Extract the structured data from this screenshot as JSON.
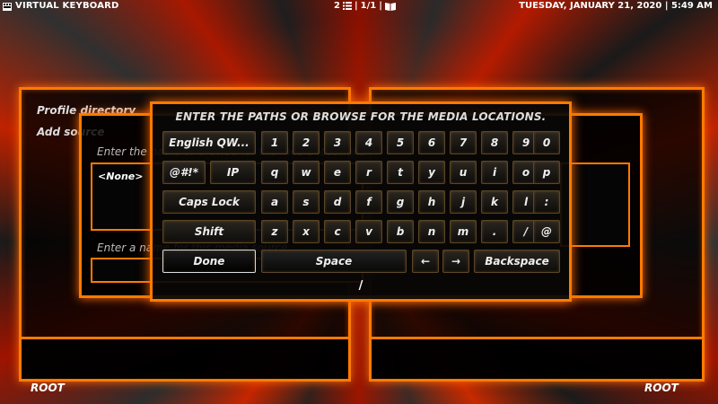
{
  "header": {
    "title": "VIRTUAL KEYBOARD",
    "page_indicator": "2",
    "page_count": "1/1",
    "datetime": "TUESDAY, JANUARY 21, 2020 | 5:49 AM"
  },
  "left_panel": {
    "items": [
      "Profile directory",
      "Add source"
    ],
    "footer": "ROOT"
  },
  "right_panel": {
    "footer": "ROOT"
  },
  "source_dialog": {
    "label_paths": "Enter the paths or browse for the media locations.",
    "paths": [
      "<None>"
    ],
    "label_name": "Enter a name for this media source."
  },
  "keyboard": {
    "heading": "ENTER THE PATHS OR BROWSE FOR THE MEDIA LOCATIONS.",
    "layout_button": "English QW...",
    "symbols_button": "@#!*",
    "ip_button": "IP",
    "caps_button": "Caps Lock",
    "shift_button": "Shift",
    "done_button": "Done",
    "space_button": "Space",
    "left_arrow": "←",
    "right_arrow": "→",
    "backspace_button": "Backspace",
    "row1": [
      "1",
      "2",
      "3",
      "4",
      "5",
      "6",
      "7",
      "8",
      "9",
      "0"
    ],
    "row2": [
      "q",
      "w",
      "e",
      "r",
      "t",
      "y",
      "u",
      "i",
      "o",
      "p"
    ],
    "row3": [
      "a",
      "s",
      "d",
      "f",
      "g",
      "h",
      "j",
      "k",
      "l",
      ":"
    ],
    "row4": [
      "z",
      "x",
      "c",
      "v",
      "b",
      "n",
      "m",
      ".",
      "/",
      "@"
    ],
    "input_value": "/"
  }
}
